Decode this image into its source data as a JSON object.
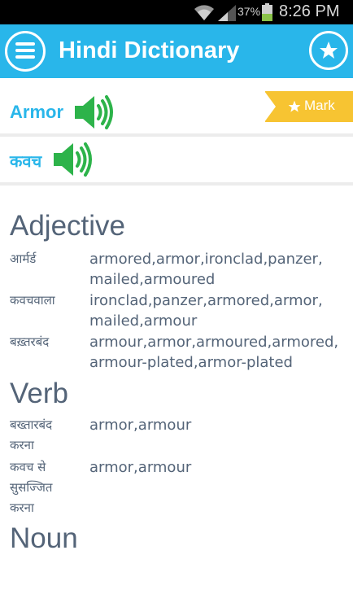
{
  "status_bar": {
    "battery_percent": "37%",
    "time": "8:26 PM",
    "icons": [
      "wifi-icon",
      "signal-icon",
      "battery-icon"
    ]
  },
  "app_bar": {
    "title": "Hindi Dictionary",
    "menu_icon": "hamburger-menu-icon",
    "favorite_icon": "star-icon",
    "background_color": "#29b6ea"
  },
  "word": {
    "english": "Armor",
    "hindi": "कवच",
    "speaker_icon": "speaker-icon",
    "mark_label": "Mark",
    "mark_color": "#f7c432"
  },
  "definitions": [
    {
      "pos": "Adjective",
      "entries": [
        {
          "hindi": "आर्मर्ड",
          "english": "armored,armor,ironclad,panzer, mailed,armoured"
        },
        {
          "hindi": "कवचवाला",
          "english": "ironclad,panzer,armored,armor, mailed,armour"
        },
        {
          "hindi": "बख़्तरबंद",
          "english": "armour,armor,armoured,armored, armour-plated,armor-plated"
        }
      ]
    },
    {
      "pos": "Verb",
      "entries": [
        {
          "hindi": "बख्तारबंद करना",
          "english": "armor,armour"
        },
        {
          "hindi": "कवच से सुसज्जित करना",
          "english": "armor,armour"
        }
      ]
    },
    {
      "pos": "Noun",
      "entries": []
    }
  ]
}
